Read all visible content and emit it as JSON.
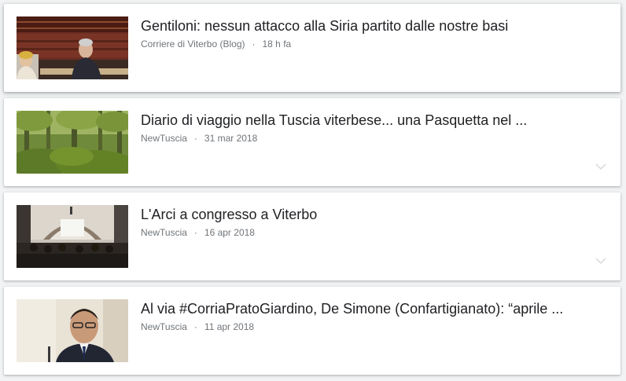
{
  "articles": [
    {
      "headline": "Gentiloni: nessun attacco alla Siria partito dalle nostre basi",
      "source": "Corriere di Viterbo (Blog)",
      "separator": "·",
      "time": "18 h fa",
      "thumbnail_icon": "parliament-photo",
      "has_expand": false
    },
    {
      "headline": "Diario di viaggio nella Tuscia viterbese... una Pasquetta nel ...",
      "source": "NewTuscia",
      "separator": "·",
      "time": "31 mar 2018",
      "thumbnail_icon": "forest-photo",
      "has_expand": true
    },
    {
      "headline": "L'Arci a congresso a Viterbo",
      "source": "NewTuscia",
      "separator": "·",
      "time": "16 apr 2018",
      "thumbnail_icon": "conference-hall-photo",
      "has_expand": true
    },
    {
      "headline": "Al via #CorriaPratoGiardino, De Simone (Confartigianato): “aprile ...",
      "source": "NewTuscia",
      "separator": "·",
      "time": "11 apr 2018",
      "thumbnail_icon": "man-portrait-photo",
      "has_expand": false
    }
  ],
  "colors": {
    "background": "#f1f3f4",
    "card": "#ffffff",
    "headline": "#202124",
    "meta": "#70757a",
    "chevron": "#dadce0"
  },
  "expand_icon": "chevron-down-icon"
}
